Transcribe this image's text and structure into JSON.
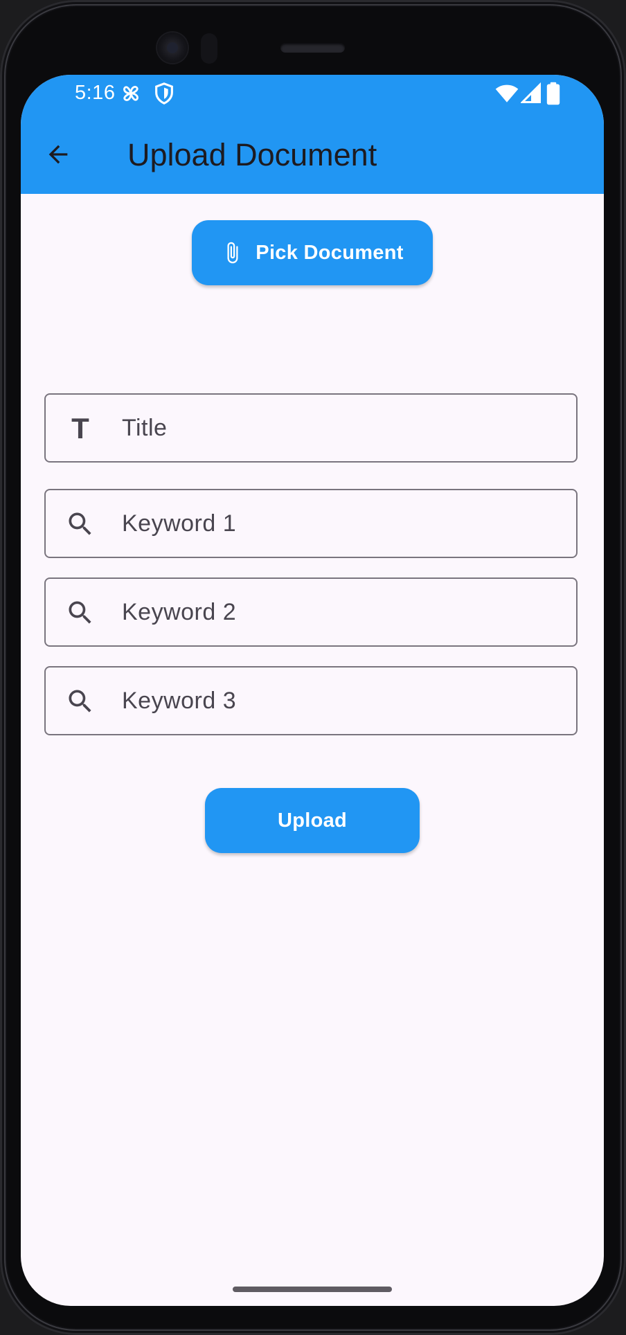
{
  "status_bar": {
    "time": "5:16",
    "left_icons": [
      "fan-icon",
      "shield-icon"
    ],
    "right_icons": [
      "wifi-icon",
      "signal-icon",
      "battery-icon"
    ]
  },
  "app_bar": {
    "title": "Upload Document",
    "back_icon": "arrow-back-icon",
    "background_color": "#2196f3"
  },
  "form": {
    "pick_button": {
      "label": "Pick Document",
      "icon": "paperclip-icon"
    },
    "fields": [
      {
        "icon": "title-t-icon",
        "placeholder": "Title",
        "value": ""
      },
      {
        "icon": "search-icon",
        "placeholder": "Keyword 1",
        "value": ""
      },
      {
        "icon": "search-icon",
        "placeholder": "Keyword 2",
        "value": ""
      },
      {
        "icon": "search-icon",
        "placeholder": "Keyword 3",
        "value": ""
      }
    ],
    "upload_button": {
      "label": "Upload"
    }
  },
  "colors": {
    "accent": "#2196f3",
    "surface": "#fcf7fd",
    "outline": "#79747e",
    "on_surface_variant": "#49454f"
  }
}
